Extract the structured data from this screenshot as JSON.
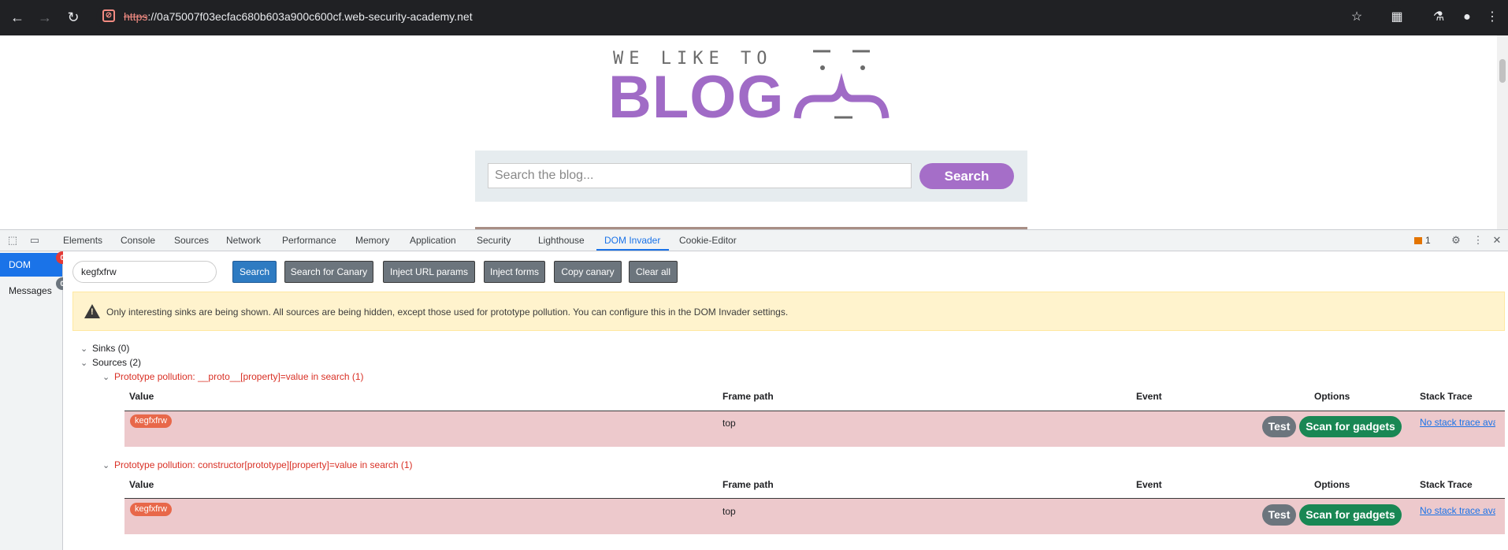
{
  "browser": {
    "url_scheme": "https",
    "url_rest": "://0a75007f03ecfac680b603a900c600cf.web-security-academy.net"
  },
  "page": {
    "logo_tagline": "WE LIKE TO",
    "logo_word": "BLOG",
    "search_placeholder": "Search the blog...",
    "search_button": "Search"
  },
  "devtools": {
    "tabs": [
      "Elements",
      "Console",
      "Sources",
      "Network",
      "Performance",
      "Memory",
      "Application",
      "Security",
      "Lighthouse",
      "DOM Invader",
      "Cookie-Editor"
    ],
    "active_tab": "DOM Invader",
    "issues_count": "1"
  },
  "dom_invader": {
    "sidebar": {
      "dom_label": "DOM",
      "dom_badge": "0",
      "messages_label": "Messages",
      "messages_badge": "0"
    },
    "canary_value": "kegfxfrw",
    "buttons": {
      "search": "Search",
      "search_canary": "Search for Canary",
      "inject_url": "Inject URL params",
      "inject_forms": "Inject forms",
      "copy_canary": "Copy canary",
      "clear_all": "Clear all"
    },
    "warning": "Only interesting sinks are being shown. All sources are being hidden, except those used for prototype pollution. You can configure this in the DOM Invader settings.",
    "sinks_label": "Sinks (0)",
    "sources_label": "Sources (2)",
    "columns": {
      "value": "Value",
      "frame_path": "Frame path",
      "event": "Event",
      "options": "Options",
      "stack_trace": "Stack Trace"
    },
    "groups": [
      {
        "title": "Prototype pollution: __proto__[property]=value in search (1)",
        "row": {
          "value": "kegfxfrw",
          "frame_path": "top",
          "event": "",
          "test": "Test",
          "scan": "Scan for gadgets",
          "stack": "No stack trace available"
        }
      },
      {
        "title": "Prototype pollution: constructor[prototype][property]=value in search (1)",
        "row": {
          "value": "kegfxfrw",
          "frame_path": "top",
          "event": "",
          "test": "Test",
          "scan": "Scan for gadgets",
          "stack": "No stack trace available"
        }
      }
    ]
  }
}
